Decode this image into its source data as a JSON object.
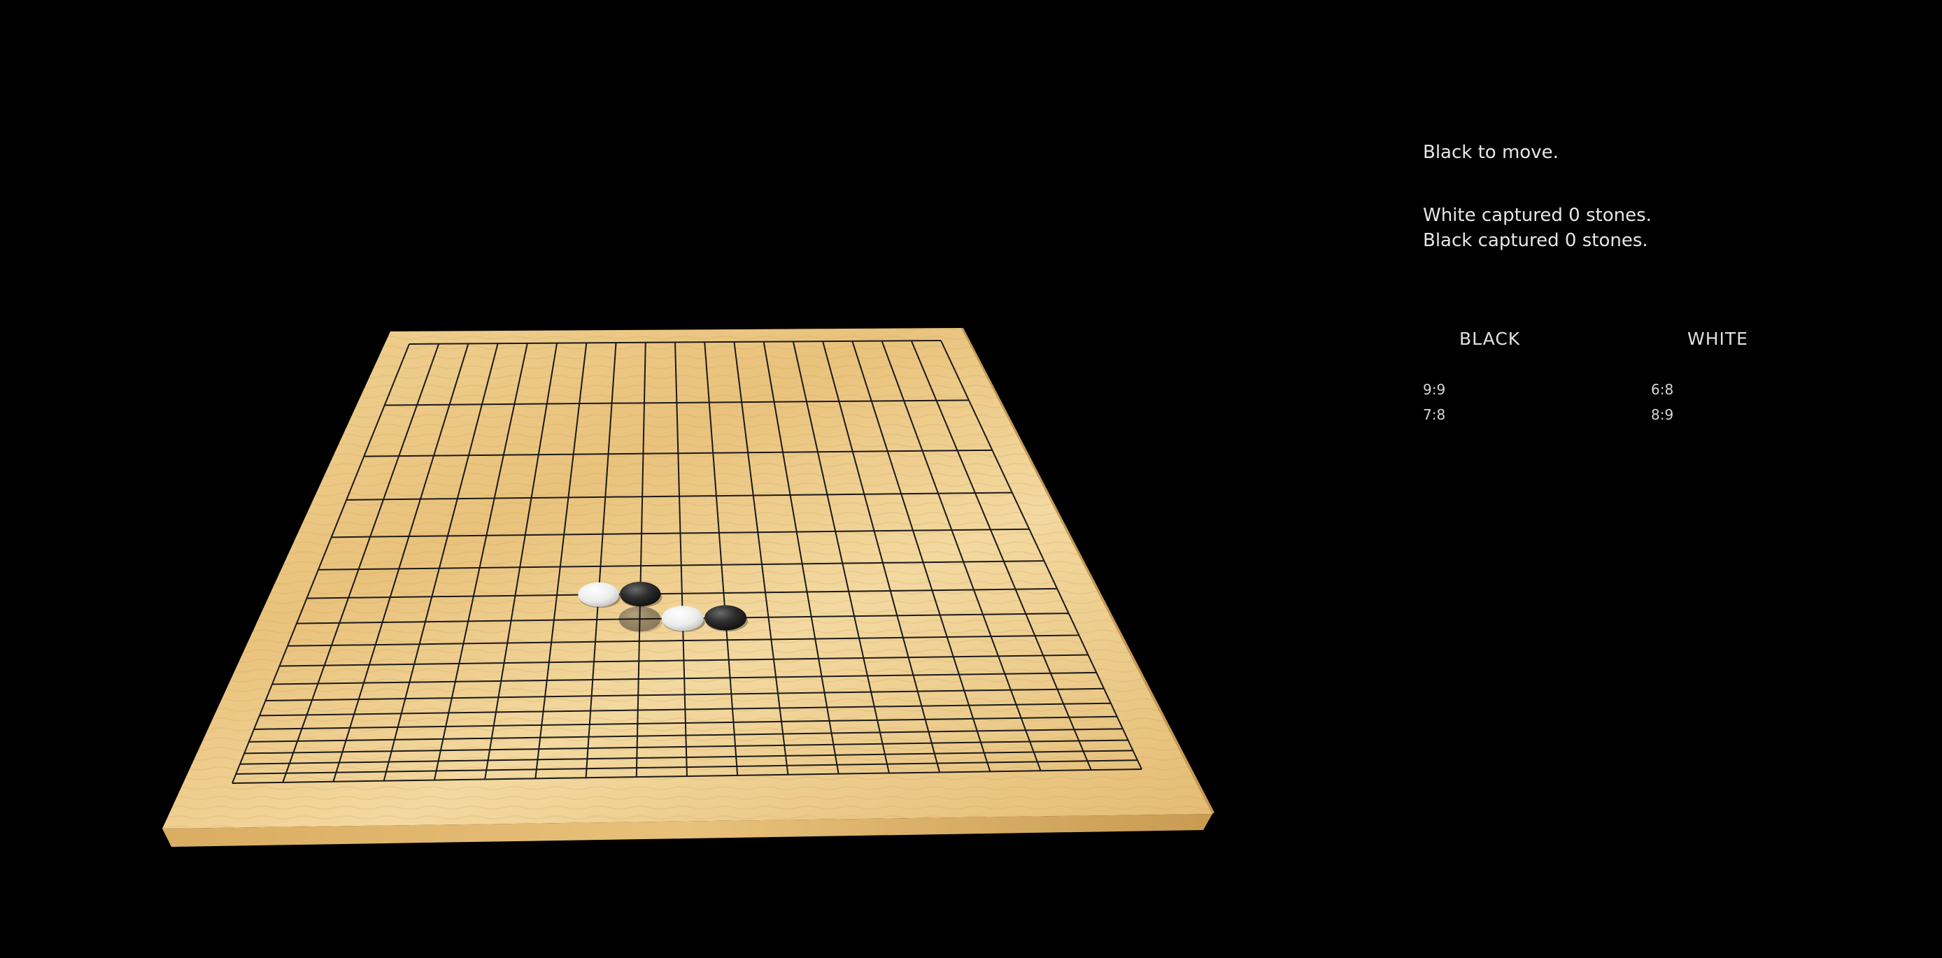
{
  "game": {
    "board_size": 19,
    "colors": {
      "background": "#000000",
      "board_light": "#f0d394",
      "board_dark": "#d7ae62",
      "grid_line": "#1a1a1a",
      "black_stone": "#2a2a2a",
      "white_stone": "#f4f4f4"
    },
    "stones": [
      {
        "color": "white",
        "col": 7,
        "row": 6
      },
      {
        "color": "black",
        "col": 8,
        "row": 6
      },
      {
        "color": "white",
        "col": 9,
        "row": 7
      },
      {
        "color": "black",
        "col": 10,
        "row": 7
      }
    ],
    "hover_preview": {
      "color": "black",
      "col": 8,
      "row": 7
    }
  },
  "status": {
    "turn": "Black to move.",
    "white_captured": "White captured 0 stones.",
    "black_captured": "Black captured 0 stones."
  },
  "history": {
    "black_header": "BLACK",
    "white_header": "WHITE",
    "black_moves": [
      "9:9",
      "7:8"
    ],
    "white_moves": [
      "6:8",
      "8:9"
    ]
  }
}
